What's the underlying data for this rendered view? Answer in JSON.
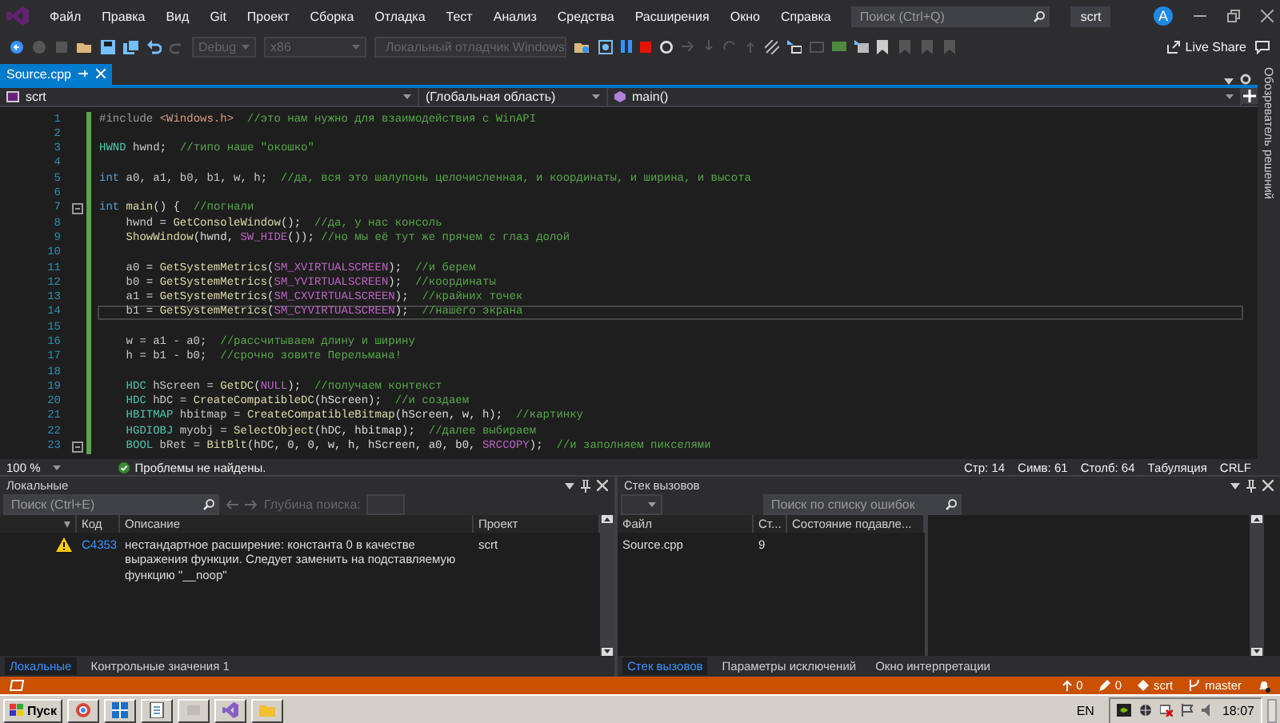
{
  "window": {
    "menu": [
      "Файл",
      "Правка",
      "Вид",
      "Git",
      "Проект",
      "Сборка",
      "Отладка",
      "Тест",
      "Анализ",
      "Средства",
      "Расширения",
      "Окно",
      "Справка"
    ],
    "search": {
      "placeholder": "Поиск (Ctrl+Q)"
    },
    "solution": "scrt",
    "avatar": "A"
  },
  "toolbar": {
    "configuration": {
      "value": "Debug",
      "disabled": true
    },
    "platform": {
      "value": "x86",
      "disabled": true
    },
    "debugger": {
      "label": "Локальный отладчик Windows",
      "disabled": true
    },
    "live_share": "Live Share"
  },
  "tabs": [
    {
      "label": "Source.cpp",
      "selected": true
    }
  ],
  "navigation": {
    "project": "scrt",
    "scope": "(Глобальная область)",
    "member": "main()"
  },
  "editor": {
    "lines": [
      {
        "number": "1",
        "current": false,
        "fold": false,
        "tokens": [
          {
            "text": "#include ",
            "kind": "pp"
          },
          {
            "text": "<Windows.h>",
            "kind": "str"
          },
          {
            "text": "  //это нам нужно для взаимодействия с WinAPI",
            "kind": "comment"
          }
        ]
      },
      {
        "number": "2",
        "current": false,
        "fold": false
      },
      {
        "number": "3",
        "current": false,
        "fold": false,
        "tokens": [
          {
            "text": "HWND",
            "kind": "type"
          },
          {
            "text": " hwnd",
            "kind": "var"
          },
          {
            "text": ";  ",
            "kind": "plain"
          },
          {
            "text": "//типо наше \"окошко\"",
            "kind": "comment"
          }
        ]
      },
      {
        "number": "4",
        "current": false,
        "fold": false
      },
      {
        "number": "5",
        "current": false,
        "fold": false,
        "tokens": [
          {
            "text": "int",
            "kind": "kw"
          },
          {
            "text": " a0, a1, b0, b1, w, h;",
            "kind": "var"
          },
          {
            "text": "  //да, вся это шалупонь целочисленная, и координаты, и ширина, и высота",
            "kind": "comment"
          }
        ]
      },
      {
        "number": "6",
        "current": false,
        "fold": false
      },
      {
        "number": "7",
        "current": false,
        "fold": true,
        "tokens": [
          {
            "text": "int",
            "kind": "kw"
          },
          {
            "text": " main",
            "kind": "fn"
          },
          {
            "text": "() {  ",
            "kind": "plain"
          },
          {
            "text": "//погнали",
            "kind": "comment"
          }
        ]
      },
      {
        "number": "8",
        "current": false,
        "fold": false,
        "tokens": [
          {
            "text": "    hwnd",
            "kind": "var"
          },
          {
            "text": " = ",
            "kind": "plain"
          },
          {
            "text": "GetConsoleWindow",
            "kind": "fn"
          },
          {
            "text": "();  ",
            "kind": "plain"
          },
          {
            "text": "//да, у нас консоль",
            "kind": "comment"
          }
        ]
      },
      {
        "number": "9",
        "current": false,
        "fold": false,
        "tokens": [
          {
            "text": "    ShowWindow",
            "kind": "fn"
          },
          {
            "text": "(hwnd, ",
            "kind": "plain"
          },
          {
            "text": "SW_HIDE",
            "kind": "macro"
          },
          {
            "text": "()); ",
            "kind": "plain"
          },
          {
            "text": "//но мы её тут же прячем с глаз долой",
            "kind": "comment"
          }
        ]
      },
      {
        "number": "10",
        "current": false,
        "fold": false
      },
      {
        "number": "11",
        "current": false,
        "fold": false,
        "tokens": [
          {
            "text": "    a0",
            "kind": "var"
          },
          {
            "text": " = ",
            "kind": "plain"
          },
          {
            "text": "GetSystemMetrics",
            "kind": "fn"
          },
          {
            "text": "(",
            "kind": "plain"
          },
          {
            "text": "SM_XVIRTUALSCREEN",
            "kind": "macro"
          },
          {
            "text": ");  ",
            "kind": "plain"
          },
          {
            "text": "//и берем",
            "kind": "comment"
          }
        ]
      },
      {
        "number": "12",
        "current": false,
        "fold": false,
        "tokens": [
          {
            "text": "    b0",
            "kind": "var"
          },
          {
            "text": " = ",
            "kind": "plain"
          },
          {
            "text": "GetSystemMetrics",
            "kind": "fn"
          },
          {
            "text": "(",
            "kind": "plain"
          },
          {
            "text": "SM_YVIRTUALSCREEN",
            "kind": "macro"
          },
          {
            "text": ");  ",
            "kind": "plain"
          },
          {
            "text": "//координаты",
            "kind": "comment"
          }
        ]
      },
      {
        "number": "13",
        "current": false,
        "fold": false,
        "tokens": [
          {
            "text": "    a1",
            "kind": "var"
          },
          {
            "text": " = ",
            "kind": "plain"
          },
          {
            "text": "GetSystemMetrics",
            "kind": "fn"
          },
          {
            "text": "(",
            "kind": "plain"
          },
          {
            "text": "SM_CXVIRTUALSCREEN",
            "kind": "macro"
          },
          {
            "text": ");  ",
            "kind": "plain"
          },
          {
            "text": "//крайних точек",
            "kind": "comment"
          }
        ]
      },
      {
        "number": "14",
        "current": true,
        "fold": false,
        "tokens": [
          {
            "text": "    b1",
            "kind": "var"
          },
          {
            "text": " = ",
            "kind": "plain"
          },
          {
            "text": "GetSystemMetrics",
            "kind": "fn"
          },
          {
            "text": "(",
            "kind": "plain"
          },
          {
            "text": "SM_CYVIRTUALSCREEN",
            "kind": "macro"
          },
          {
            "text": ");  ",
            "kind": "plain"
          },
          {
            "text": "//нашего экрана",
            "kind": "comment"
          }
        ]
      },
      {
        "number": "15",
        "current": false,
        "fold": false
      },
      {
        "number": "16",
        "current": false,
        "fold": false,
        "tokens": [
          {
            "text": "    w = a1 - a0;",
            "kind": "var"
          },
          {
            "text": "  //рассчитываем длину и ширину",
            "kind": "comment"
          }
        ]
      },
      {
        "number": "17",
        "current": false,
        "fold": false,
        "tokens": [
          {
            "text": "    h = b1 - b0;",
            "kind": "var"
          },
          {
            "text": "  //срочно зовите Перельмана!",
            "kind": "comment"
          }
        ]
      },
      {
        "number": "18",
        "current": false,
        "fold": false
      },
      {
        "number": "19",
        "current": false,
        "fold": false,
        "tokens": [
          {
            "text": "    HDC",
            "kind": "type"
          },
          {
            "text": " hScreen = ",
            "kind": "var"
          },
          {
            "text": "GetDC",
            "kind": "fn"
          },
          {
            "text": "(",
            "kind": "plain"
          },
          {
            "text": "NULL",
            "kind": "macro"
          },
          {
            "text": ");  ",
            "kind": "plain"
          },
          {
            "text": "//получаем контекст",
            "kind": "comment"
          }
        ]
      },
      {
        "number": "20",
        "current": false,
        "fold": false,
        "tokens": [
          {
            "text": "    HDC",
            "kind": "type"
          },
          {
            "text": " hDC = ",
            "kind": "var"
          },
          {
            "text": "CreateCompatibleDC",
            "kind": "fn"
          },
          {
            "text": "(hScreen);  ",
            "kind": "plain"
          },
          {
            "text": "//и создаем",
            "kind": "comment"
          }
        ]
      },
      {
        "number": "21",
        "current": false,
        "fold": false,
        "tokens": [
          {
            "text": "    HBITMAP",
            "kind": "type"
          },
          {
            "text": " hbitmap = ",
            "kind": "var"
          },
          {
            "text": "CreateCompatibleBitmap",
            "kind": "fn"
          },
          {
            "text": "(hScreen, w, h);  ",
            "kind": "plain"
          },
          {
            "text": "//картинку",
            "kind": "comment"
          }
        ]
      },
      {
        "number": "22",
        "current": false,
        "fold": false,
        "tokens": [
          {
            "text": "    HGDIOBJ",
            "kind": "type"
          },
          {
            "text": " myobj = ",
            "kind": "var"
          },
          {
            "text": "SelectObject",
            "kind": "fn"
          },
          {
            "text": "(hDC, hbitmap);  ",
            "kind": "plain"
          },
          {
            "text": "//далее выбираем",
            "kind": "comment"
          }
        ]
      },
      {
        "number": "23",
        "current": false,
        "fold": true,
        "tokens": [
          {
            "text": "    BOOL",
            "kind": "type"
          },
          {
            "text": " bRet = ",
            "kind": "var"
          },
          {
            "text": "BitBlt",
            "kind": "fn"
          },
          {
            "text": "(hDC, 0, 0, w, h, hScreen, a0, b0, ",
            "kind": "plain"
          },
          {
            "text": "SRCCOPY",
            "kind": "macro"
          },
          {
            "text": ");  ",
            "kind": "plain"
          },
          {
            "text": "//и заполняем пикселями",
            "kind": "comment"
          }
        ]
      }
    ]
  },
  "editor_status": {
    "zoom": "100 %",
    "issues": "Проблемы не найдены.",
    "line": "Стр: 14",
    "char": "Симв: 61",
    "column": "Столб: 64",
    "indent": "Табуляция",
    "eol": "CRLF"
  },
  "side_tab": "Обозреватель решений",
  "locals_panel": {
    "title": "Локальные",
    "search": {
      "placeholder": "Поиск (Ctrl+E)"
    },
    "depth_label": "Глубина поиска:",
    "columns": [
      "Код",
      "Описание",
      "Проект"
    ],
    "rows": [
      {
        "code": "C4353",
        "description": "нестандартное расширение: константа 0 в качестве выражения функции.  Следует заменить на подставляемую функцию \"__noop\"",
        "project": "scrt"
      }
    ],
    "tabs": [
      {
        "label": "Локальные",
        "selected": true
      },
      {
        "label": "Контрольные значения 1",
        "selected": false
      }
    ]
  },
  "call_stack_panel": {
    "title": "Стек вызовов",
    "search": {
      "placeholder": "Поиск по списку ошибок"
    },
    "columns": [
      "Файл",
      "Ст...",
      "Состояние подавле..."
    ],
    "rows": [
      {
        "file": "Source.cpp",
        "line": "9"
      }
    ],
    "tabs": [
      {
        "label": "Стек вызовов",
        "selected": true
      },
      {
        "label": "Параметры исключений",
        "selected": false
      },
      {
        "label": "Окно интерпретации",
        "selected": false
      }
    ]
  },
  "status_bar": {
    "push_count": "0",
    "changes": "0",
    "repository": "scrt",
    "branch": "master"
  },
  "taskbar": {
    "start": "Пуск",
    "language": "EN",
    "time": "18:07"
  }
}
